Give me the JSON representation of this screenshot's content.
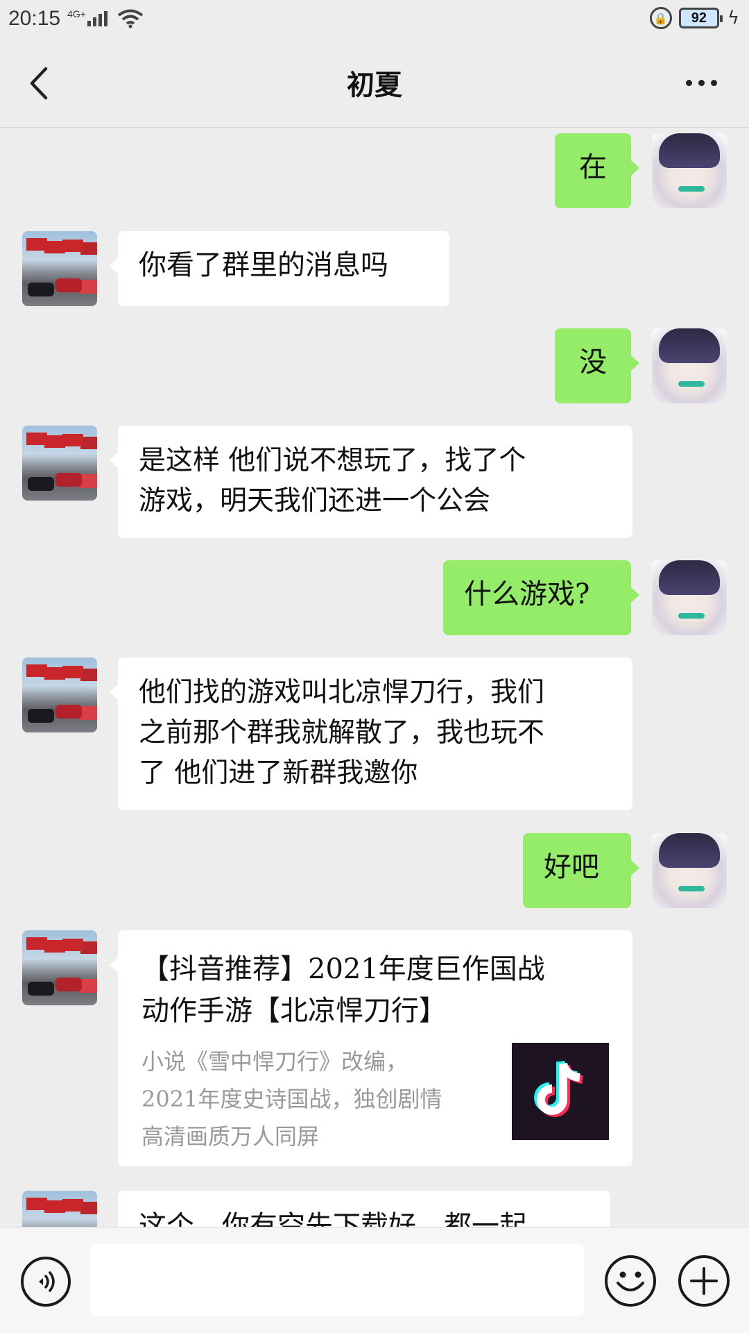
{
  "status_bar": {
    "time": "20:15",
    "network": "4G+",
    "battery": "92"
  },
  "header": {
    "title": "初夏",
    "back_icon": "chevron-left-icon",
    "more_icon": "more-horizontal-icon"
  },
  "messages": [
    {
      "from": "me",
      "text": "在"
    },
    {
      "from": "other",
      "text": "你看了群里的消息吗"
    },
    {
      "from": "me",
      "text": "没"
    },
    {
      "from": "other",
      "line1": "是这样 他们说不想玩了，找了个",
      "line2": "游戏，明天我们还进一个公会"
    },
    {
      "from": "me",
      "text": "什么游戏?"
    },
    {
      "from": "other",
      "line1": "他们找的游戏叫北凉悍刀行，我们",
      "line2": "之前那个群我就解散了，我也玩不",
      "line3": "了 他们进了新群我邀你"
    },
    {
      "from": "me",
      "text": "好吧"
    },
    {
      "from": "other",
      "type": "link_card",
      "title_line1": "【抖音推荐】2021年度巨作国战",
      "title_line2": "动作手游【北凉悍刀行】",
      "desc_line1": "小说《雪中悍刀行》改编，",
      "desc_line2": "2021年度史诗国战，独创剧情",
      "desc_line3": "高清画质万人同屏",
      "thumb_icon": "tiktok-logo-icon"
    },
    {
      "from": "other",
      "text": "这个，你有空先下载好，都一起"
    }
  ],
  "input_bar": {
    "value": "",
    "voice_icon": "voice-icon",
    "emoji_icon": "emoji-icon",
    "plus_icon": "plus-circle-icon"
  },
  "colors": {
    "background": "#ededed",
    "outgoing_bubble": "#95ec69",
    "incoming_bubble": "#ffffff",
    "card_desc": "#999999"
  }
}
